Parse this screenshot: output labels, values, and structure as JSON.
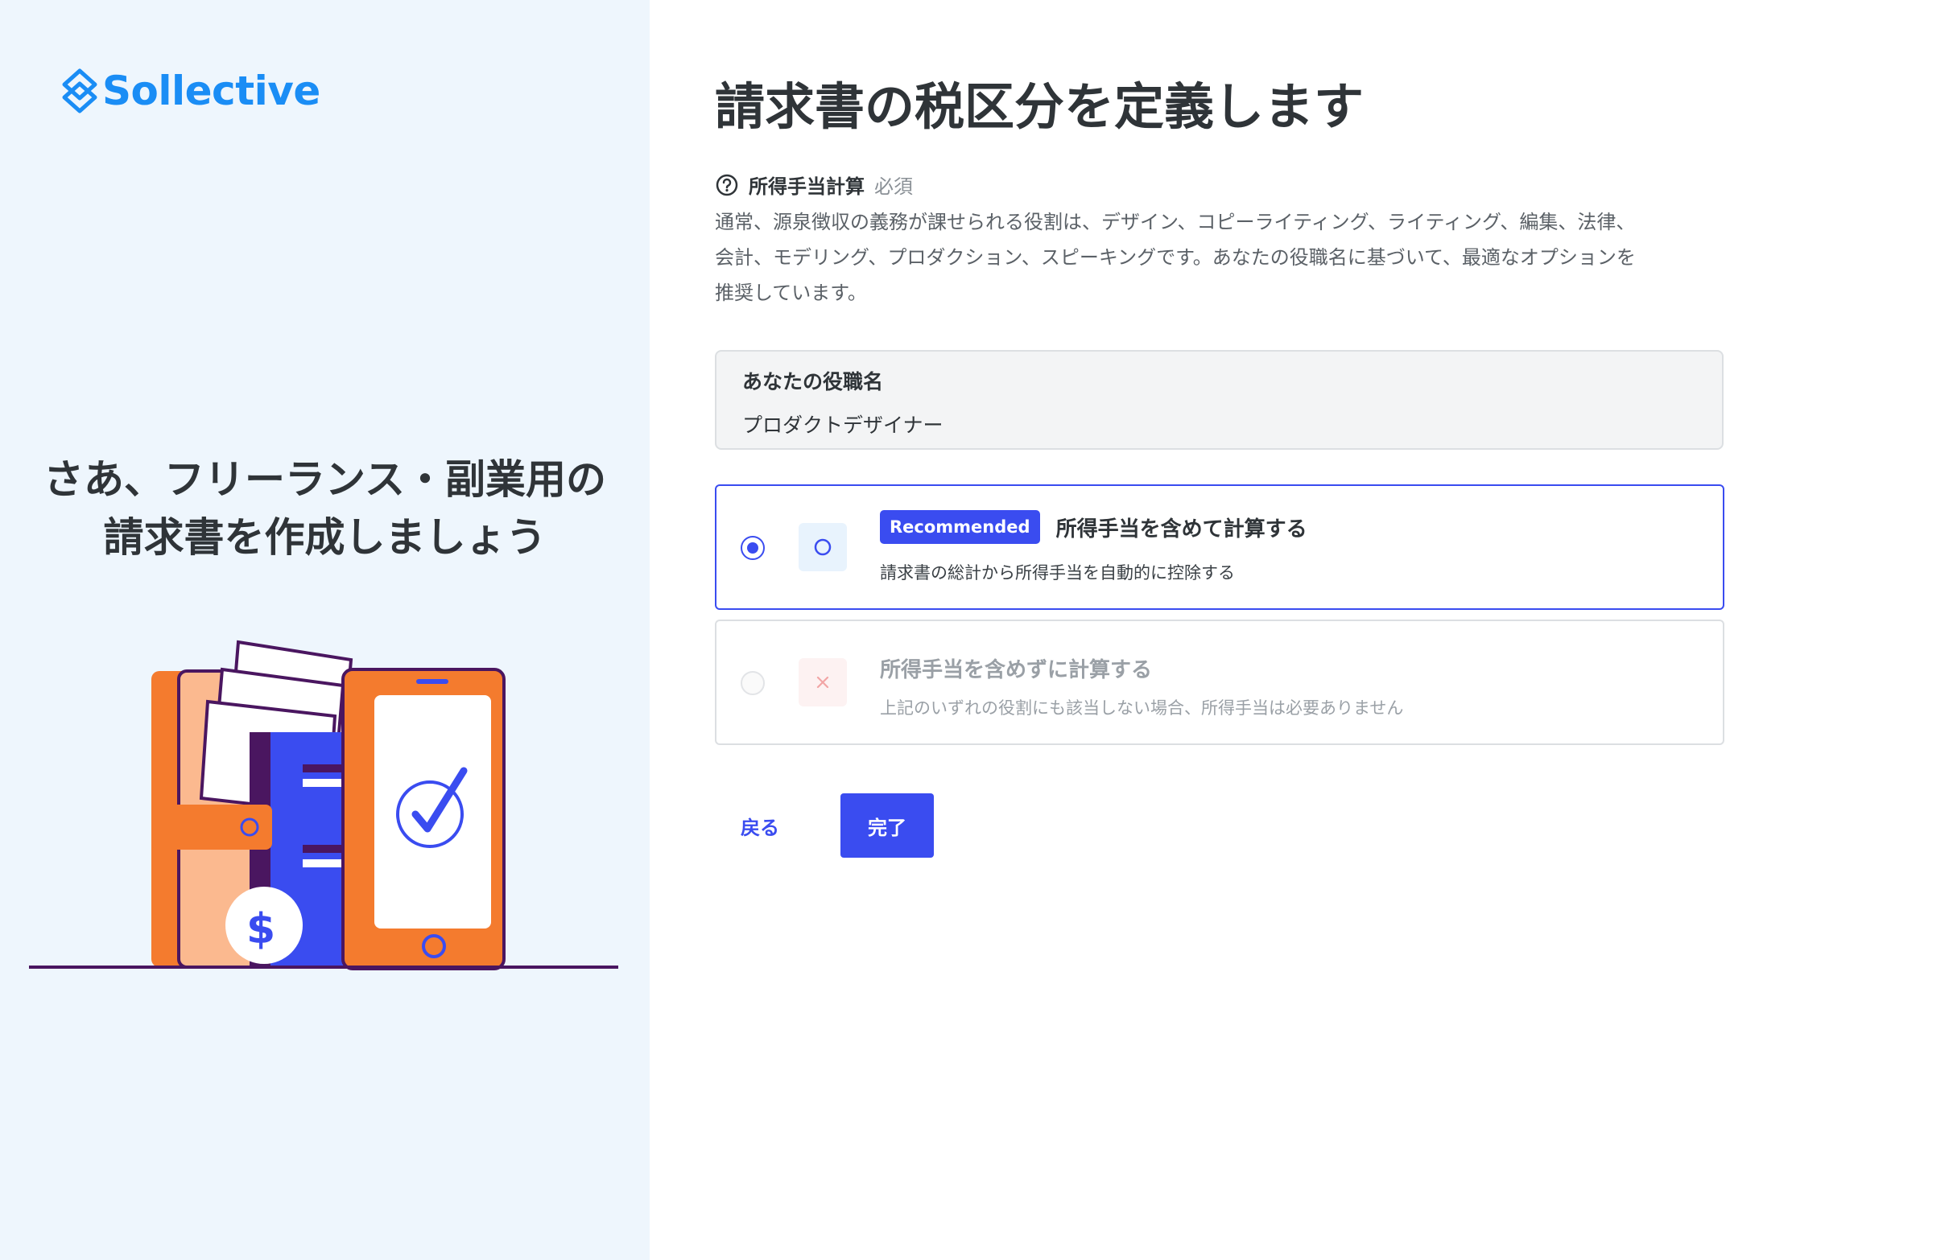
{
  "brand": {
    "name": "Sollective",
    "color": "#1a8df5"
  },
  "left": {
    "tagline_line1": "さあ、フリーランス・副業用の",
    "tagline_line2": "請求書を作成しましょう"
  },
  "main": {
    "title": "請求書の税区分を定義します",
    "field_label": "所得手当計算",
    "required_label": "必須",
    "description_line1": "通常、源泉徴収の義務が課せられる役割は、デザイン、コピーライティング、ライティング、編集、法律、",
    "description_line2": "会計、モデリング、プロダクション、スピーキングです。あなたの役職名に基づいて、最適なオプションを",
    "description_line3": "推奨しています。"
  },
  "job": {
    "label": "あなたの役職名",
    "value": "プロダクトデザイナー"
  },
  "options": [
    {
      "badge": "Recommended",
      "title": "所得手当を含めて計算する",
      "subtitle": "請求書の総計から所得手当を自動的に控除する",
      "selected": true,
      "icon": "circle-icon"
    },
    {
      "title": "所得手当を含めずに計算する",
      "subtitle": "上記のいずれの役割にも該当しない場合、所得手当は必要ありません",
      "selected": false,
      "icon": "x-icon"
    }
  ],
  "actions": {
    "back_label": "戻る",
    "done_label": "完了"
  },
  "colors": {
    "accent": "#3a4cf0",
    "left_panel_bg": "#eef6fd",
    "illustration_orange": "#f47b2e",
    "illustration_blue": "#3a4cf0",
    "illustration_purple": "#4a1660"
  }
}
